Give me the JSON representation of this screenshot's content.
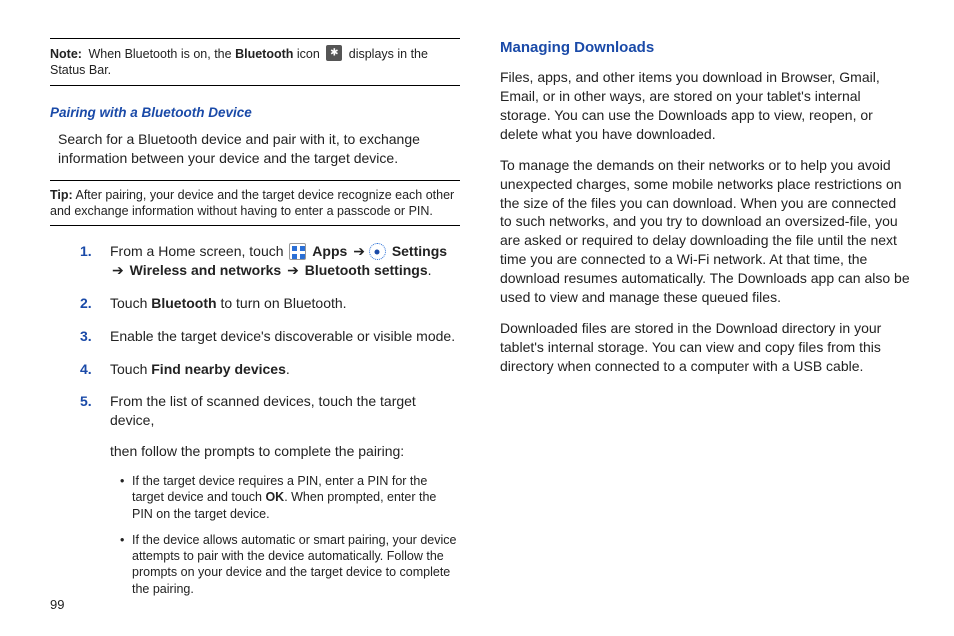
{
  "left": {
    "note": {
      "lead": "Note:",
      "pre": "When Bluetooth is on, the ",
      "bold": "Bluetooth",
      "mid": " icon ",
      "iconName": "bluetooth-icon",
      "post": " displays in the Status Bar."
    },
    "subHeading": "Pairing with a Bluetooth Device",
    "intro": "Search for a Bluetooth device and pair with it, to exchange information between your device and the target device.",
    "tip": {
      "lead": "Tip:",
      "text": "After pairing, your device and the target device recognize each other and exchange information without having to enter a passcode or PIN."
    },
    "steps": [
      {
        "num": "1.",
        "pre": "From a Home screen, touch ",
        "appsIcon": "apps-icon",
        "appsLabel": "Apps",
        "arrow1": "➔",
        "settingsIcon": "settings-icon",
        "settingsLabel": "Settings",
        "arrow2": "➔",
        "path2": "Wireless and networks",
        "arrow3": "➔",
        "path3": "Bluetooth settings",
        "tail": "."
      },
      {
        "num": "2.",
        "pre": "Touch ",
        "bold": "Bluetooth",
        "post": " to turn on Bluetooth."
      },
      {
        "num": "3.",
        "text": "Enable the target device's discoverable or visible mode."
      },
      {
        "num": "4.",
        "pre": "Touch ",
        "bold": "Find nearby devices",
        "post": "."
      },
      {
        "num": "5.",
        "line1": "From the list of scanned devices, touch the target device,",
        "line2": "then follow the prompts to complete the pairing:",
        "bullets": [
          {
            "pre": "If the target device requires a PIN, enter a PIN for the target device and touch ",
            "bold": "OK",
            "post": ". When prompted, enter the PIN on the target device."
          },
          {
            "text": "If the device allows automatic or smart pairing, your device attempts to pair with the device automatically. Follow the prompts on your device and the target device to complete the pairing."
          }
        ]
      }
    ]
  },
  "right": {
    "heading": "Managing Downloads",
    "p1": "Files, apps, and other items you download in Browser, Gmail, Email, or in other ways, are stored on your tablet's internal storage. You can use the Downloads app to view, reopen, or delete what you have downloaded.",
    "p2": "To manage the demands on their networks or to help you avoid unexpected charges, some mobile networks place restrictions on the size of the files you can download. When you are connected to such networks, and you try to download an oversized-file, you are asked or required to delay downloading the file until the next time you are connected to a Wi-Fi network. At that time, the download resumes automatically. The Downloads app can also be used to view and manage these queued files.",
    "p3": "Downloaded files are stored in the Download directory in your tablet's internal storage. You can view and copy files from this directory when connected to a computer with a USB cable."
  },
  "pageNumber": "99"
}
